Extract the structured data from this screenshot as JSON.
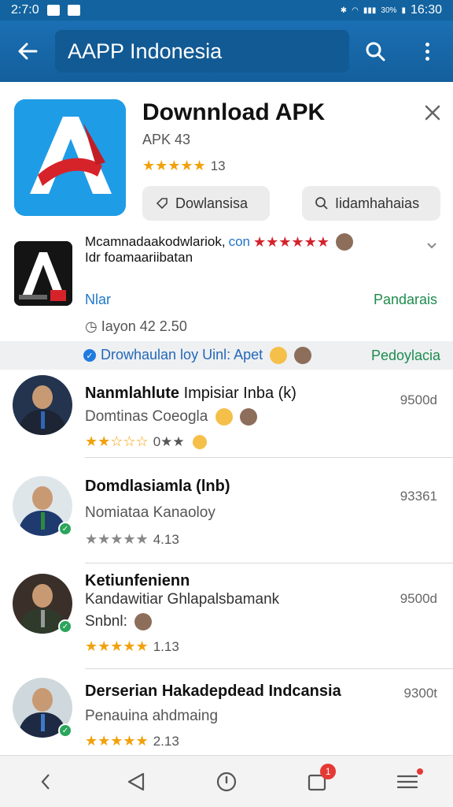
{
  "status_bar": {
    "time": "2:7:0",
    "battery": "30%",
    "clock": "16:30"
  },
  "app_bar": {
    "search_value": "AAPP Indonesia"
  },
  "app_card": {
    "title": "Downnload APK",
    "subtitle": "APK 43",
    "rating_stars": "★★★★★",
    "rating_value": "13",
    "button1_label": "Dowlansisa",
    "button2_label": "Iidamhahaias"
  },
  "promo": {
    "line1_text": "Mcamnadaakodwlariok,",
    "line1_link": "con",
    "line1_stars": "★★★★★★",
    "line2_text": "Idr foamaariibatan",
    "left_link": "Nlar",
    "right_link": "Pandarais",
    "version": "Iayon 42 2.50"
  },
  "info_strip": {
    "text": "Drowhaulan loy Uinl: Apet",
    "right": "Pedoylacia"
  },
  "list": [
    {
      "name_bold": "Nanmlahlute",
      "name_thin": "Impisiar Inba (k)",
      "sub": "Domtinas Coeogla",
      "stars": "★★☆☆☆",
      "rating": "0★★",
      "meta": "9500d",
      "verified": false
    },
    {
      "name_bold": "Domdlasiamla (lnb)",
      "name_thin": "",
      "sub": "Nomiataa Kanaoloy",
      "stars": "★★★★★",
      "rating": "4.13",
      "meta": "93361",
      "verified": true
    },
    {
      "name_bold": "Ketiunfenienn",
      "name_thin": "",
      "sub": "Kandawitiar Ghlapalsbamank",
      "sub2": "Snbnl:",
      "stars": "★★★★★",
      "rating": "1.13",
      "meta": "9500d",
      "verified": true
    },
    {
      "name_bold": "Derserian Hakadepdead Indcansia",
      "name_thin": "",
      "sub": "Penauina ahdmaing",
      "stars": "★★★★★",
      "rating": "2.13",
      "meta": "9300t",
      "verified": true
    }
  ],
  "bottom_nav": {
    "notif_count": "1"
  },
  "colors": {
    "app_bar": "#1a6fb3",
    "accent_green": "#1e8c4e",
    "link_blue": "#2078c9",
    "star_gold": "#f2a10b"
  }
}
